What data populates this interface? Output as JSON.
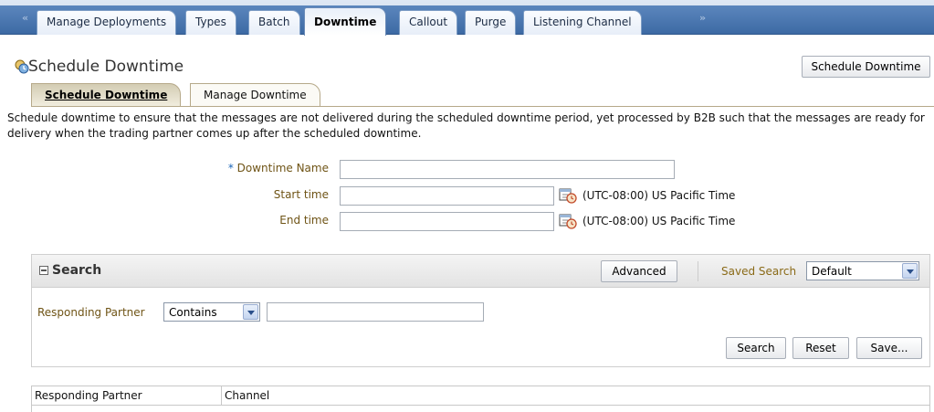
{
  "tabs": [
    {
      "label": "Manage Deployments",
      "active": false
    },
    {
      "label": "Types",
      "active": false
    },
    {
      "label": "Batch",
      "active": false
    },
    {
      "label": "Downtime",
      "active": true
    },
    {
      "label": "Callout",
      "active": false
    },
    {
      "label": "Purge",
      "active": false
    },
    {
      "label": "Listening Channel",
      "active": false
    }
  ],
  "header": {
    "title": "Schedule Downtime",
    "action_button": "Schedule Downtime",
    "icon": "schedule-icon"
  },
  "subtabs": [
    {
      "label": "Schedule Downtime",
      "active": true
    },
    {
      "label": "Manage Downtime",
      "active": false
    }
  ],
  "description": "Schedule downtime to ensure that the messages are not delivered during the scheduled downtime period, yet processed by B2B such that the messages are ready for delivery when the trading partner comes up after the scheduled downtime.",
  "form": {
    "required_marker": "*",
    "downtime_name_label": "Downtime Name",
    "downtime_name_value": "",
    "start_time_label": "Start time",
    "start_time_value": "",
    "end_time_label": "End time",
    "end_time_value": "",
    "timezone": "(UTC-08:00) US Pacific Time"
  },
  "search": {
    "title": "Search",
    "advanced_button": "Advanced",
    "saved_search_label": "Saved Search",
    "saved_search_value": "Default",
    "field_label": "Responding Partner",
    "operator_value": "Contains",
    "field_value": "",
    "search_button": "Search",
    "reset_button": "Reset",
    "save_button": "Save..."
  },
  "table": {
    "columns": [
      "Responding Partner",
      "Channel"
    ]
  },
  "colors": {
    "tab_bar": "#3d6aa4",
    "label_brown": "#6f5416",
    "required_blue": "#1a64b6"
  }
}
